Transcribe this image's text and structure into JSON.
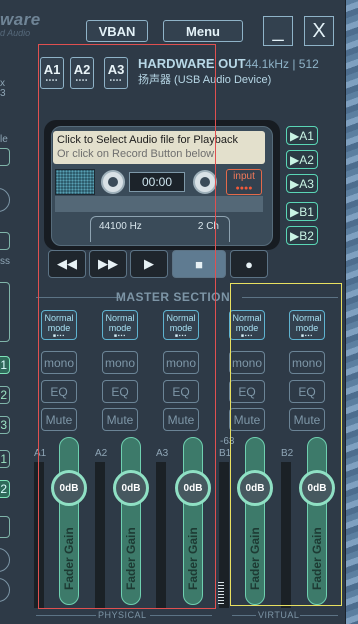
{
  "app": {
    "title_fragment": "ware",
    "subtitle_fragment": "d Audio"
  },
  "top": {
    "vban_label": "VBAN",
    "menu_label": "Menu",
    "minimize_label": "_",
    "close_label": "X"
  },
  "left_strip": {
    "text_x": "x",
    "text_3": "3",
    "text_le": "le",
    "text_ss": "ss",
    "boxes": [
      "1",
      "2",
      "3",
      "1",
      "2"
    ]
  },
  "hardware_out": {
    "buttons": [
      {
        "label": "A1",
        "dots": "••••"
      },
      {
        "label": "A2",
        "dots": "••••"
      },
      {
        "label": "A3",
        "dots": "••••"
      }
    ],
    "title": "HARDWARE OUT",
    "info": "44.1kHz | 512",
    "device": "扬声器 (USB Audio Device)"
  },
  "recorder": {
    "label_line1": "Click to Select Audio file for Playback",
    "label_line2": "Or click on Record Button below",
    "time": "00:00",
    "input_label": "input",
    "input_dots": "●●●●",
    "sample_rate": "44100 Hz",
    "channels": "2 Ch",
    "transport": {
      "rewind": "◀◀",
      "forward": "▶▶",
      "play": "▶",
      "stop": "■",
      "record": "●"
    }
  },
  "routing": [
    "▶A1",
    "▶A2",
    "▶A3",
    "▶B1",
    "▶B2"
  ],
  "master": {
    "title": "MASTER SECTION",
    "normal_mode": "Normal mode",
    "mono": "mono",
    "eq": "EQ",
    "mute": "Mute",
    "fader_value": "0dB",
    "fader_label": "Fader Gain",
    "b1_db": "-63",
    "strips": [
      "A1",
      "A2",
      "A3",
      "B1",
      "B2"
    ],
    "physical_label": "PHYSICAL",
    "virtual_label": "VIRTUAL"
  },
  "colors": {
    "background": "#2e3a47",
    "accent_green": "#8fe0c4",
    "overlay_red": "#e05050",
    "overlay_yellow": "#e8e060"
  }
}
